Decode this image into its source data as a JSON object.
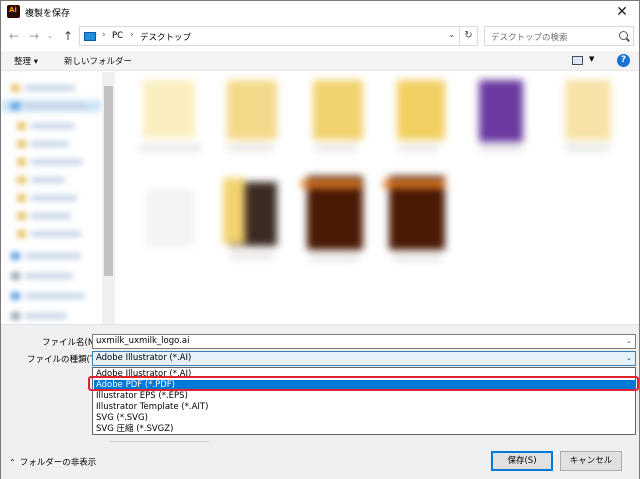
{
  "window": {
    "title": "複製を保存",
    "app_icon_text": "Ai"
  },
  "address": {
    "crumbs": [
      "PC",
      "デスクトップ"
    ],
    "search_placeholder": "デスクトップの検索"
  },
  "toolbar": {
    "organize_label": "整理 ▾",
    "new_folder_label": "新しいフォルダー"
  },
  "form": {
    "filename_label": "ファイル名(N):",
    "filename_value": "uxmilk_uxmilk_logo.ai",
    "type_label": "ファイルの種類(T):",
    "type_value": "Adobe Illustrator (*.AI)",
    "type_options": [
      "Adobe Illustrator (*.AI)",
      "Adobe PDF (*.PDF)",
      "Illustrator EPS (*.EPS)",
      "Illustrator Template (*.AIT)",
      "SVG (*.SVG)",
      "SVG 圧縮 (*.SVGZ)"
    ],
    "selected_option_index": 1
  },
  "footer": {
    "hide_folders_label": "フォルダーの非表示",
    "save_label": "保存(S)",
    "cancel_label": "キャンセル"
  },
  "colors": {
    "selection": "#0078d7",
    "highlight_border": "#e0242b"
  }
}
